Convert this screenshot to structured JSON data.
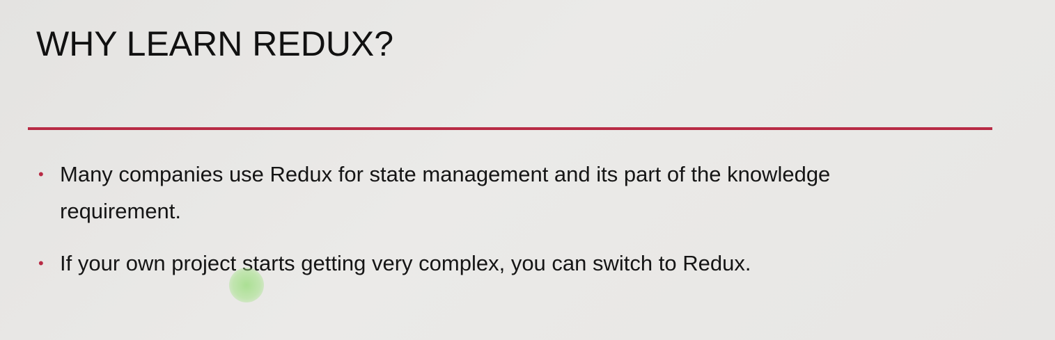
{
  "slide": {
    "title": "WHY LEARN REDUX?",
    "accent_color": "#b82b45",
    "bullets": [
      {
        "text": "Many companies use Redux for state management and its part of the knowledge requirement."
      },
      {
        "text": "If your own project starts getting very complex, you can switch to Redux."
      }
    ],
    "bullet_glyph": "•"
  }
}
